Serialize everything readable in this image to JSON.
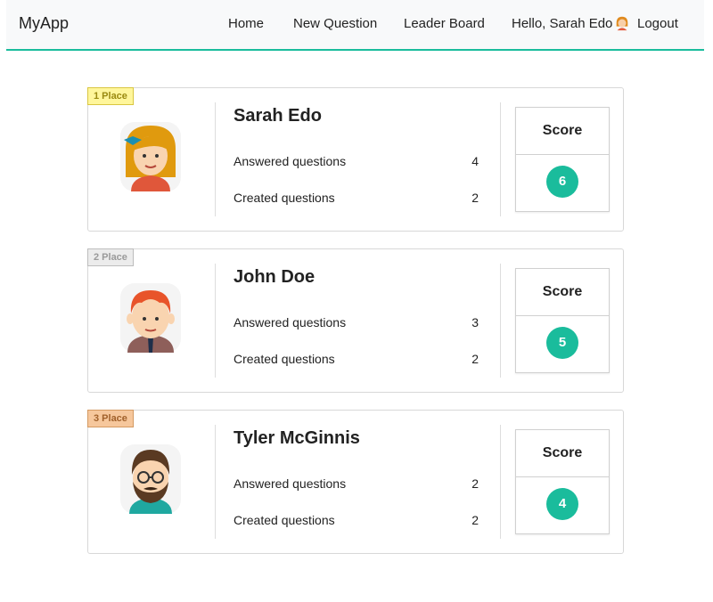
{
  "navbar": {
    "brand": "MyApp",
    "links": [
      "Home",
      "New Question",
      "Leader Board"
    ],
    "greeting": "Hello, Sarah Edo",
    "logout": "Logout",
    "accent": "#1abc9c"
  },
  "leaderboard": [
    {
      "place": "1 Place",
      "name": "Sarah Edo",
      "answered_label": "Answered questions",
      "answered": "4",
      "created_label": "Created questions",
      "created": "2",
      "score_label": "Score",
      "score": "6"
    },
    {
      "place": "2 Place",
      "name": "John Doe",
      "answered_label": "Answered questions",
      "answered": "3",
      "created_label": "Created questions",
      "created": "2",
      "score_label": "Score",
      "score": "5"
    },
    {
      "place": "3 Place",
      "name": "Tyler McGinnis",
      "answered_label": "Answered questions",
      "answered": "2",
      "created_label": "Created questions",
      "created": "2",
      "score_label": "Score",
      "score": "4"
    }
  ]
}
